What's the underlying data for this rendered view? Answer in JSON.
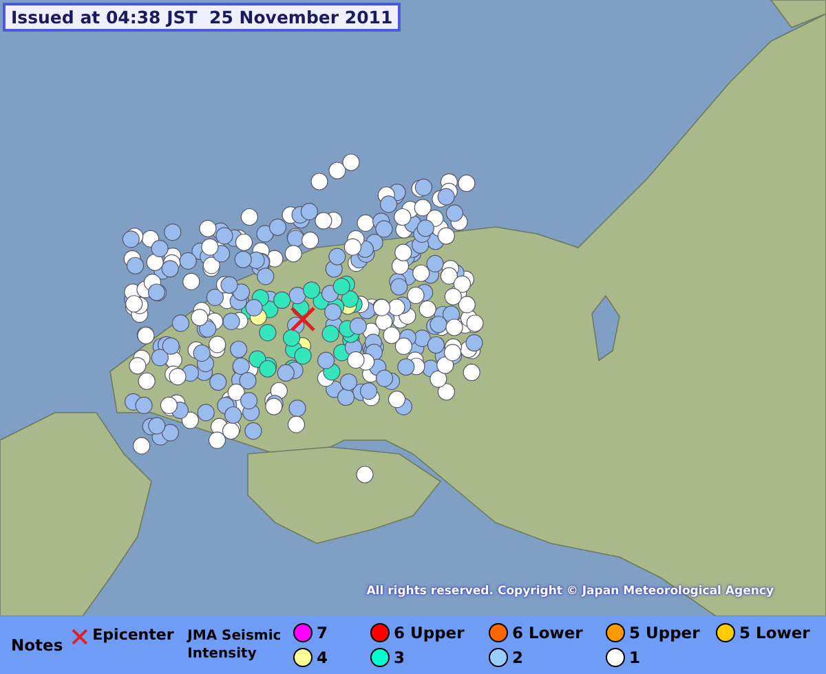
{
  "title": "Issued at 04:38 JST  25 November 2011",
  "copyright": "All rights reserved. Copyright © Japan Meteorological Agency",
  "legend": {
    "notes": "Notes",
    "epicenter": "Epicenter",
    "intensity_title": "JMA Seismic Intensity",
    "levels": [
      {
        "label": "7",
        "color": "#ff00ff"
      },
      {
        "label": "6 Upper",
        "color": "#ff0000"
      },
      {
        "label": "6 Lower",
        "color": "#ff6600"
      },
      {
        "label": "5 Upper",
        "color": "#ff9900"
      },
      {
        "label": "5 Lower",
        "color": "#ffcc00"
      },
      {
        "label": "4",
        "color": "#ffff99"
      },
      {
        "label": "3",
        "color": "#00ffcc"
      },
      {
        "label": "2",
        "color": "#99ccff"
      },
      {
        "label": "1",
        "color": "#ffffff"
      }
    ]
  }
}
